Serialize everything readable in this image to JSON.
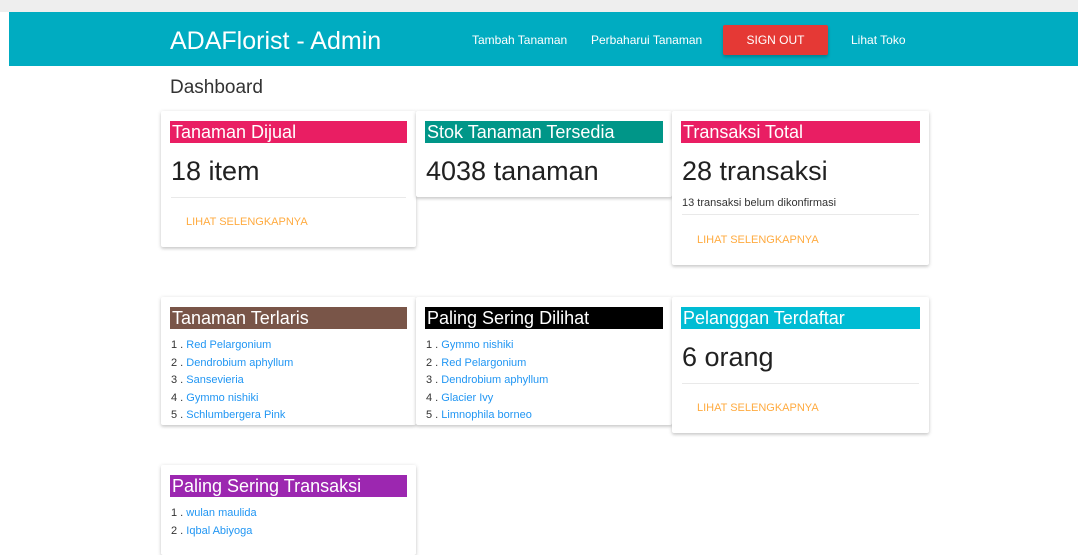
{
  "header": {
    "brand": "ADAFlorist - Admin",
    "nav": [
      "Tambah Tanaman",
      "Perbaharui Tanaman"
    ],
    "signout": "SIGN OUT",
    "shop_link": "Lihat Toko"
  },
  "page_title": "Dashboard",
  "colors": {
    "navbar": "#00acc1",
    "signout": "#e53935",
    "link": "#2196f3",
    "more_link": "#ffab40"
  },
  "cards": {
    "tanaman_dijual": {
      "title": "Tanaman Dijual",
      "color": "#e91e63",
      "value": "18 item",
      "more": "LIHAT SELENGKAPNYA"
    },
    "stok": {
      "title": "Stok Tanaman Tersedia",
      "color": "#009688",
      "value": "4038 tanaman"
    },
    "transaksi": {
      "title": "Transaksi Total",
      "color": "#e91e63",
      "value": "28 transaksi",
      "note": "13 transaksi belum dikonfirmasi",
      "more": "LIHAT SELENGKAPNYA"
    },
    "terlaris": {
      "title": "Tanaman Terlaris",
      "color": "#795548",
      "items": [
        "Red Pelargonium",
        "Dendrobium aphyllum",
        "Sansevieria",
        "Gymmo nishiki",
        "Schlumbergera Pink"
      ]
    },
    "dilihat": {
      "title": "Paling Sering Dilihat",
      "color": "#000000",
      "items": [
        "Gymmo nishiki",
        "Red Pelargonium",
        "Dendrobium aphyllum",
        "Glacier Ivy",
        "Limnophila borneo"
      ]
    },
    "pelanggan": {
      "title": "Pelanggan Terdaftar",
      "color": "#00bcd4",
      "value": "6 orang",
      "more": "LIHAT SELENGKAPNYA"
    },
    "sering_transaksi": {
      "title": "Paling Sering Transaksi",
      "color": "#9c27b0",
      "items": [
        "wulan maulida",
        "Iqbal Abiyoga"
      ]
    }
  }
}
